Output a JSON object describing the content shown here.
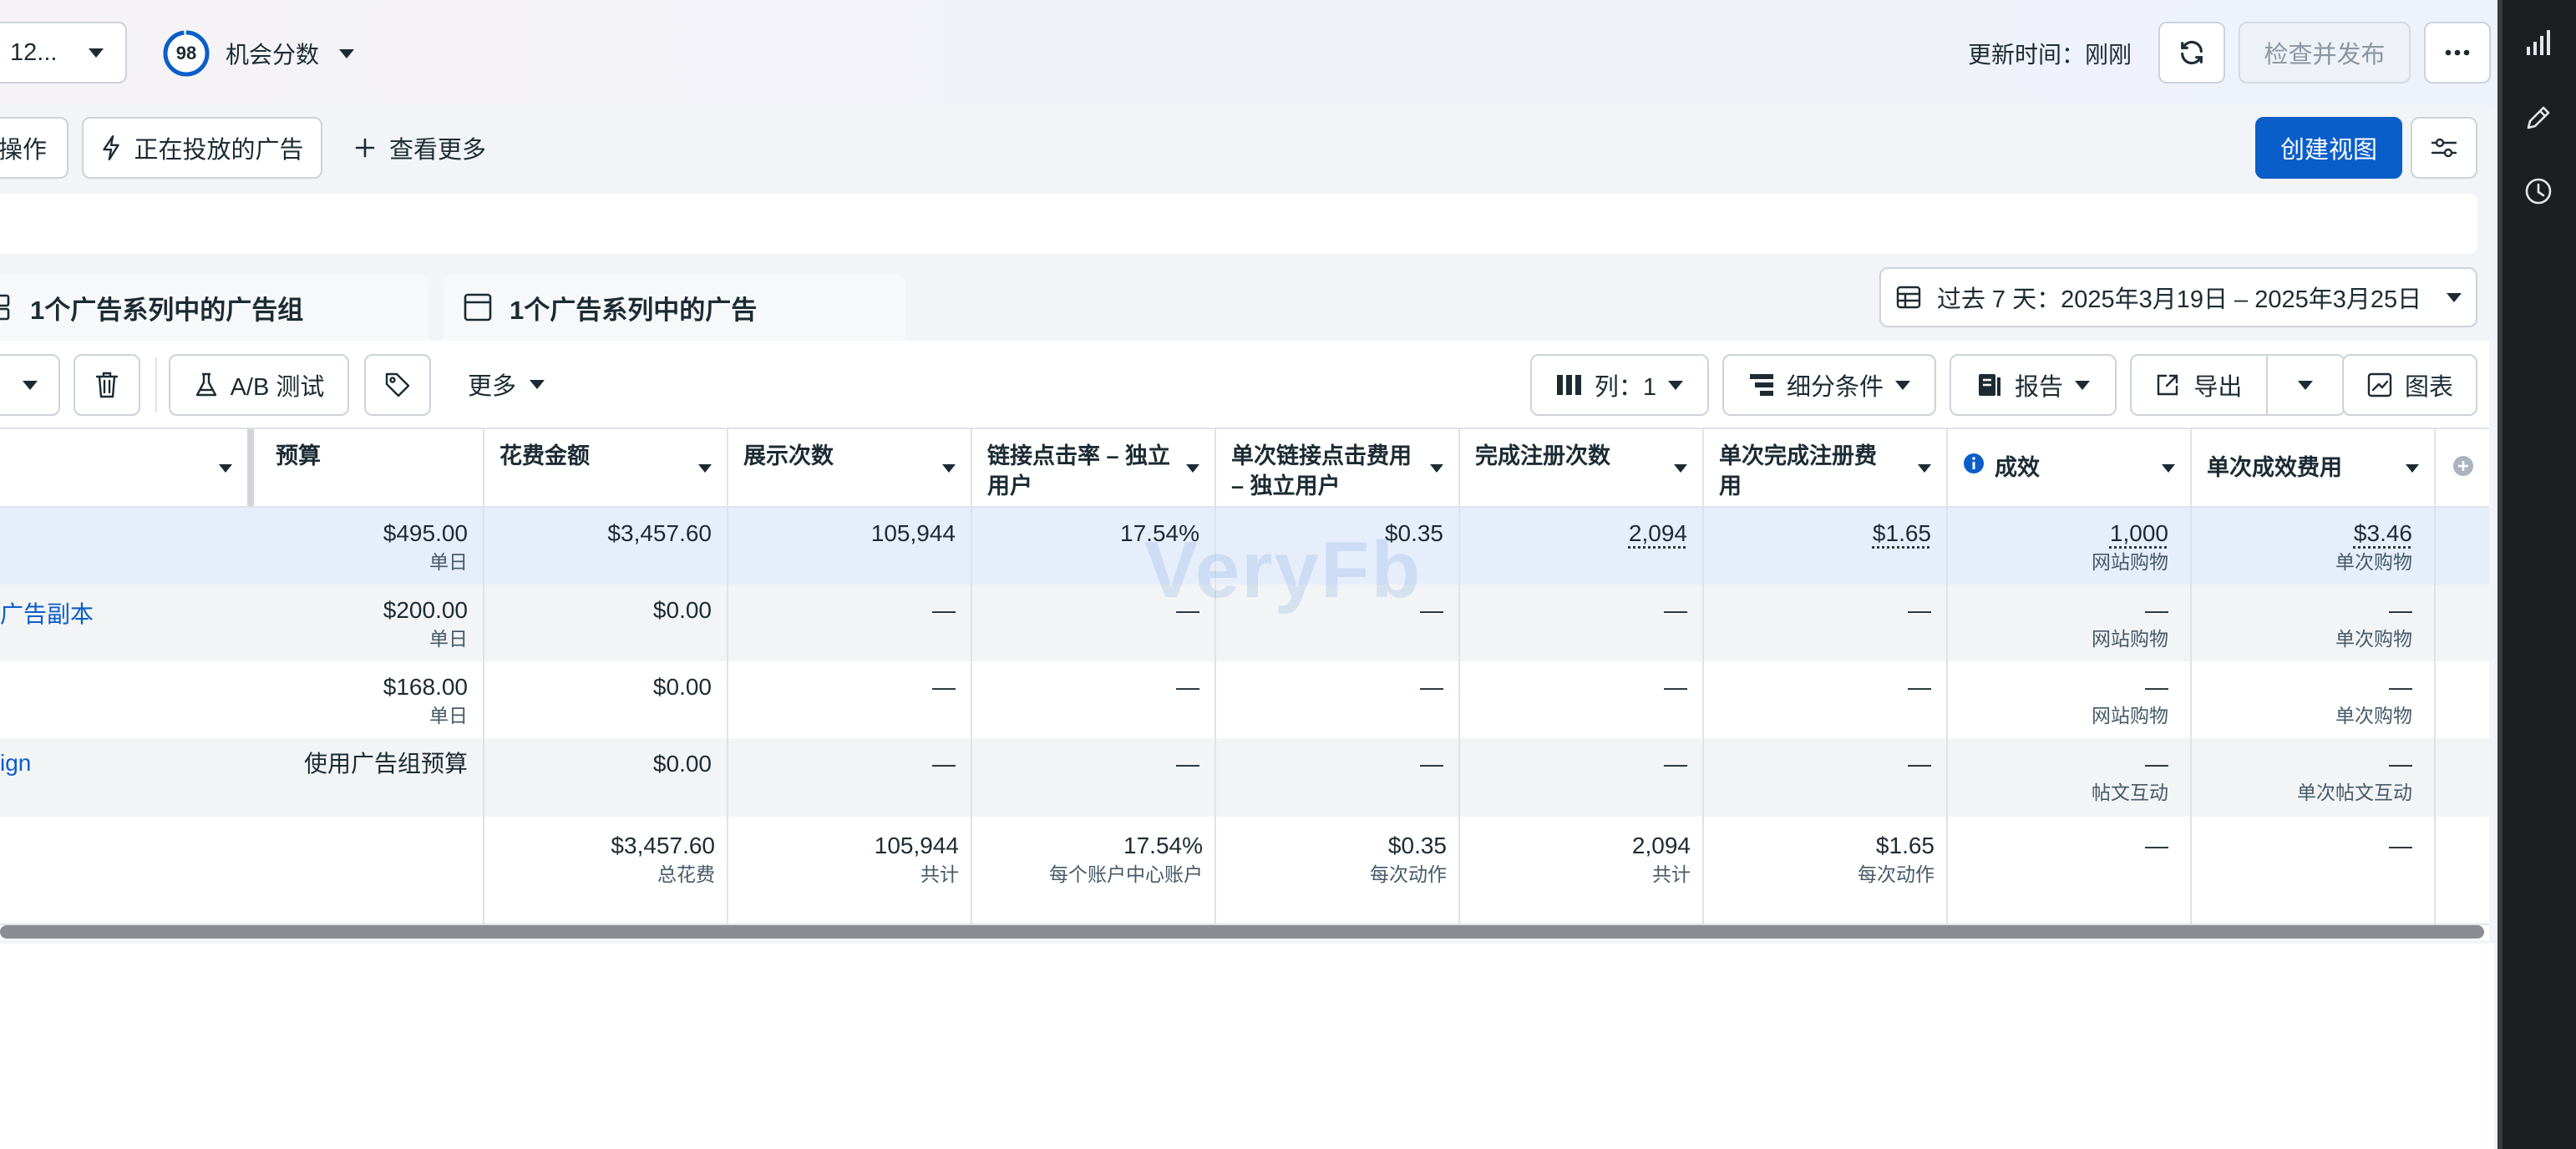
{
  "topbar": {
    "account_label": "12...",
    "score_value": "98",
    "score_label": "机会分数",
    "updated_text": "更新时间：刚刚",
    "publish_label": "检查并发布"
  },
  "filterbar": {
    "actions_label": "操作",
    "active_ads_label": "正在投放的广告",
    "see_more_label": "查看更多",
    "create_view_label": "创建视图"
  },
  "tabs": [
    {
      "label": "1个广告系列中的广告组"
    },
    {
      "label": "1个广告系列中的广告"
    }
  ],
  "date_range": {
    "label": "过去 7 天：2025年3月19日 – 2025年3月25日"
  },
  "toolbar": {
    "ab_test_label": "A/B 测试",
    "more_label": "更多",
    "columns_label": "列：1",
    "breakdown_label": "细分条件",
    "reports_label": "报告",
    "export_label": "导出",
    "chart_label": "图表"
  },
  "table": {
    "headers": [
      "预算",
      "花费金额",
      "展示次数",
      "链接点击率 – 独立用户",
      "单次链接点击费用 – 独立用户",
      "完成注册次数",
      "单次完成注册费用",
      "成效",
      "单次成效费用"
    ],
    "rows": [
      {
        "name": "",
        "budget": "$495.00",
        "budget_sub": "单日",
        "spend": "$3,457.60",
        "impressions": "105,944",
        "ctr": "17.54%",
        "cpc": "$0.35",
        "regs": "2,094",
        "cost_reg": "$1.65",
        "results": "1,000",
        "results_sub": "网站购物",
        "cpr": "$3.46",
        "cpr_sub": "单次购物"
      },
      {
        "name": "广告副本",
        "budget": "$200.00",
        "budget_sub": "单日",
        "spend": "$0.00",
        "impressions": "—",
        "ctr": "—",
        "cpc": "—",
        "regs": "—",
        "cost_reg": "—",
        "results": "—",
        "results_sub": "网站购物",
        "cpr": "—",
        "cpr_sub": "单次购物"
      },
      {
        "name": "",
        "budget": "$168.00",
        "budget_sub": "单日",
        "spend": "$0.00",
        "impressions": "—",
        "ctr": "—",
        "cpc": "—",
        "regs": "—",
        "cost_reg": "—",
        "results": "—",
        "results_sub": "网站购物",
        "cpr": "—",
        "cpr_sub": "单次购物"
      },
      {
        "name": "ign",
        "budget": "使用广告组预算",
        "budget_sub": "",
        "spend": "$0.00",
        "impressions": "—",
        "ctr": "—",
        "cpc": "—",
        "regs": "—",
        "cost_reg": "—",
        "results": "—",
        "results_sub": "帖文互动",
        "cpr": "—",
        "cpr_sub": "单次帖文互动"
      }
    ],
    "totals": {
      "spend": "$3,457.60",
      "spend_sub": "总花费",
      "impressions": "105,944",
      "impressions_sub": "共计",
      "ctr": "17.54%",
      "ctr_sub": "每个账户中心账户",
      "cpc": "$0.35",
      "cpc_sub": "每次动作",
      "regs": "2,094",
      "regs_sub": "共计",
      "cost_reg": "$1.65",
      "cost_reg_sub": "每次动作",
      "results": "—",
      "cpr": "—"
    }
  },
  "watermark": "VeryFb",
  "colors": {
    "primary": "#0a5ec9",
    "link": "#0a5ec9",
    "selected_row": "#e7eefb",
    "rail": "#1c1e21"
  },
  "icons": [
    "chevron-down-icon",
    "refresh-icon",
    "more-icon",
    "lightning-icon",
    "plus-icon",
    "sliders-icon",
    "table-icon",
    "trash-icon",
    "flask-icon",
    "tag-icon",
    "columns-icon",
    "breakdown-icon",
    "reports-icon",
    "export-icon",
    "chart-icon",
    "info-icon",
    "add-column-icon",
    "bar-chart-icon",
    "pencil-icon",
    "clock-icon"
  ]
}
